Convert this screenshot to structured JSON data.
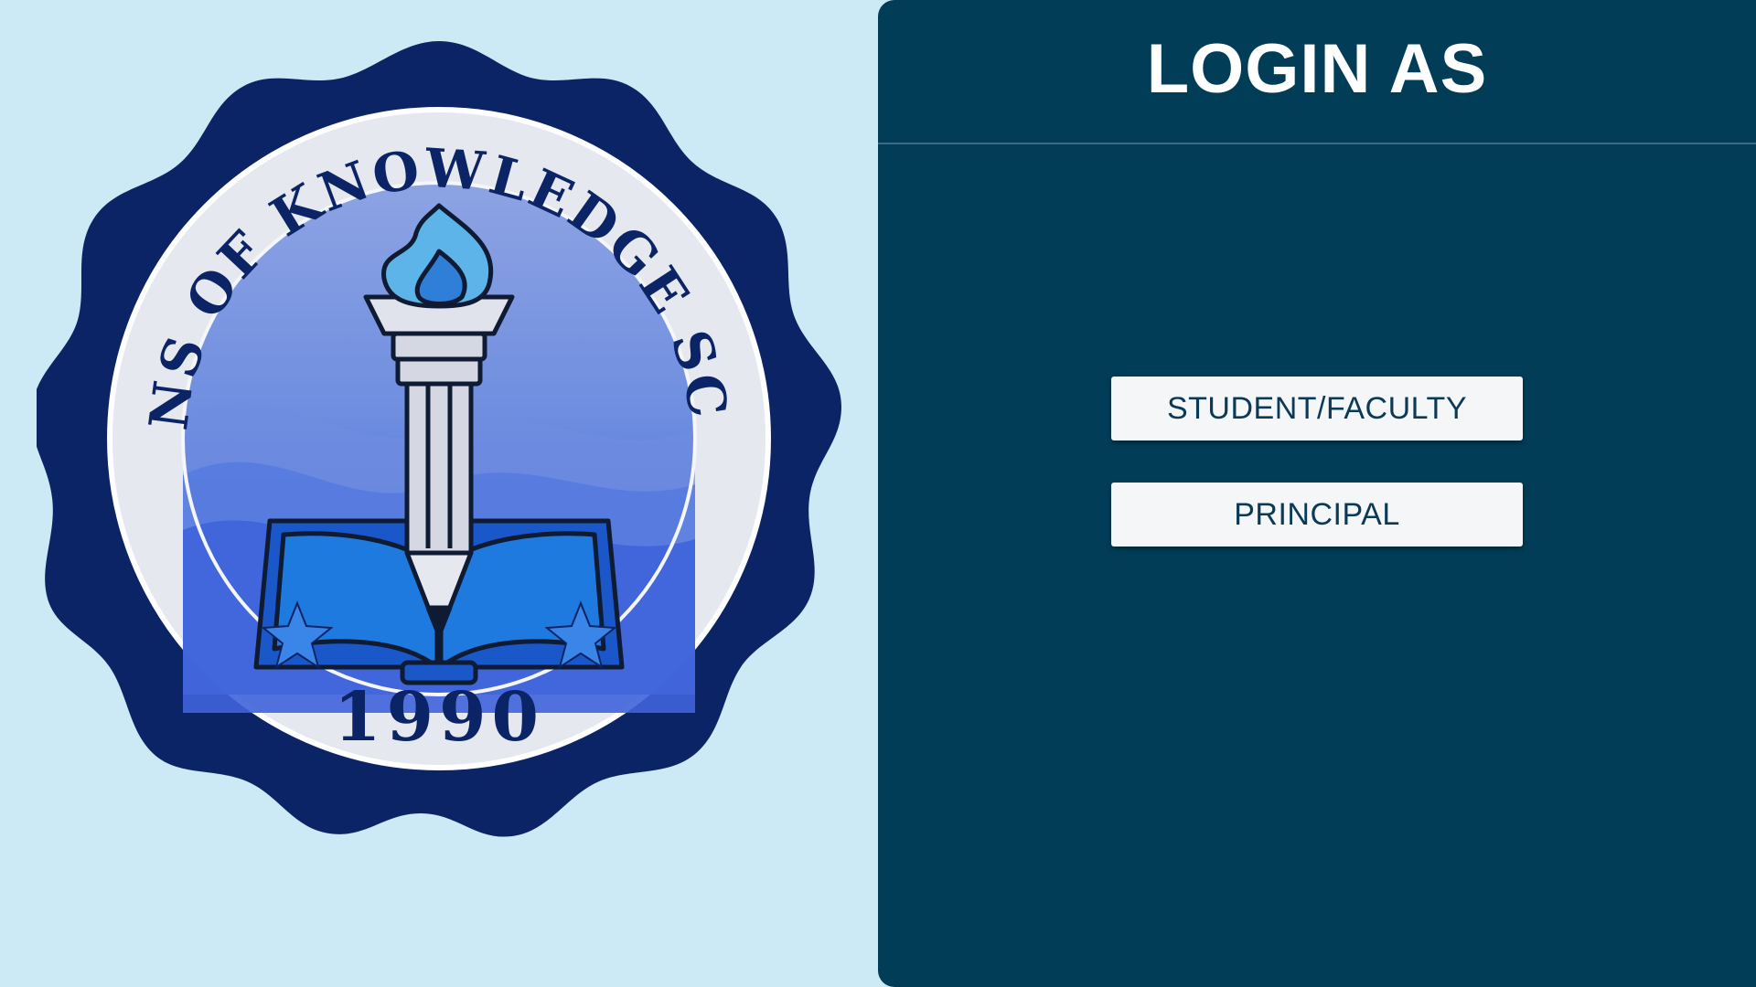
{
  "seal": {
    "school_name": "OCEANS OF KNOWLEDGE SCHOOL",
    "year": "1990"
  },
  "login": {
    "title": "LOGIN AS",
    "options": [
      {
        "label": "STUDENT/FACULTY"
      },
      {
        "label": "PRINCIPAL"
      }
    ]
  },
  "colors": {
    "background": "#cbeaf6",
    "panel": "#023d58",
    "seal_navy": "#0b2466",
    "seal_blue": "#3a63d8",
    "button_bg": "#f4f6f8",
    "button_text": "#0b3a56"
  }
}
